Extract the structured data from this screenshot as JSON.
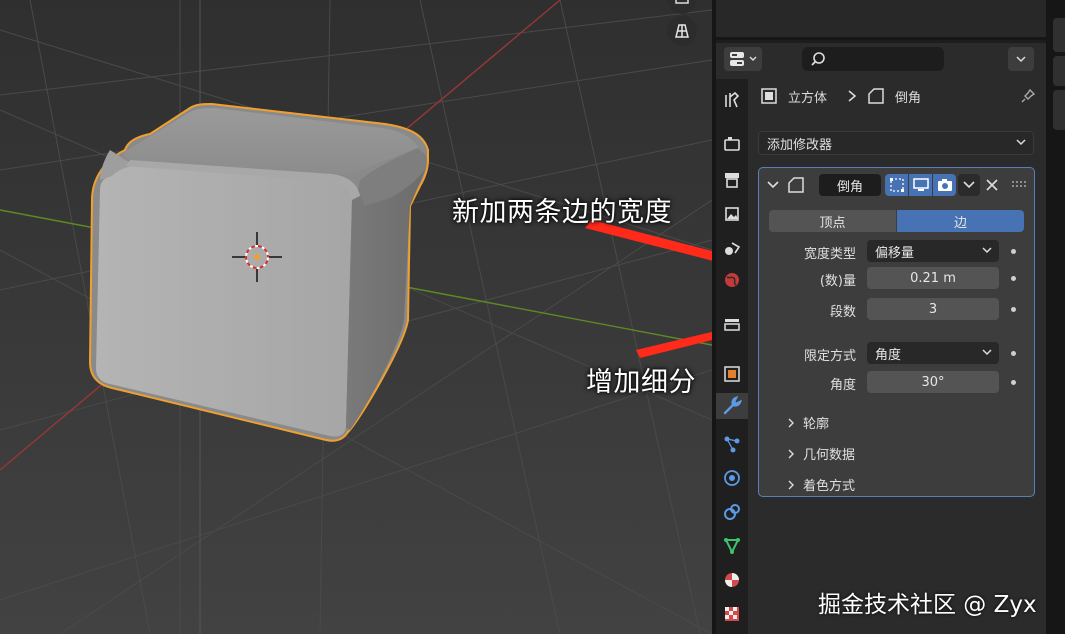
{
  "annotations": {
    "width_note": "新加两条边的宽度",
    "segments_note": "增加细分"
  },
  "properties": {
    "breadcrumb": {
      "object_name": "立方体",
      "modifier_name": "倒角"
    },
    "add_modifier_label": "添加修改器",
    "modifier": {
      "name": "倒角",
      "affect_tabs": [
        "顶点",
        "边"
      ],
      "active_tab": "边",
      "width_type_label": "宽度类型",
      "width_type_value": "偏移量",
      "amount_label": "(数)量",
      "amount_value": "0.21 m",
      "segments_label": "段数",
      "segments_value": "3",
      "limit_method_label": "限定方式",
      "limit_method_value": "角度",
      "angle_label": "角度",
      "angle_value": "30°",
      "subpanels": [
        "轮廓",
        "几何数据",
        "着色方式"
      ]
    }
  },
  "watermark": "掘金技术社区 @ Zyx",
  "colors": {
    "accent": "#4772b3",
    "selection_outline": "#f0a030",
    "annotation_arrow": "#ff2a1a",
    "x_axis": "#b03a3a",
    "y_axis": "#6a9a2a"
  }
}
